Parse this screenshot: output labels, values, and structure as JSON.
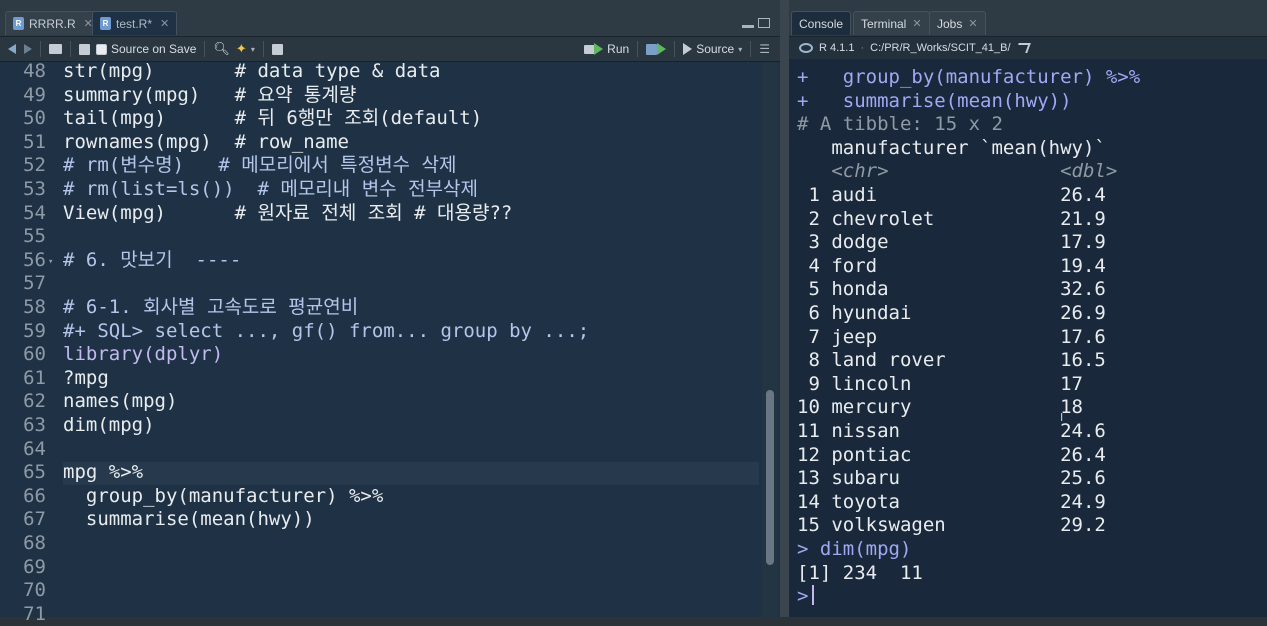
{
  "editor": {
    "tabs": [
      {
        "label": "RRRR.R",
        "icon": "r-file-icon"
      },
      {
        "label": "test.R*",
        "icon": "r-file-icon"
      }
    ],
    "toolbar": {
      "source_on_save": "Source on Save",
      "run": "Run",
      "source": "Source"
    },
    "lines": [
      {
        "num": "48",
        "code": "str(mpg)       # data type & data"
      },
      {
        "num": "49",
        "code": "summary(mpg)   # 요약 통계량"
      },
      {
        "num": "50",
        "code": "tail(mpg)      # 뒤 6행만 조회(default)"
      },
      {
        "num": "51",
        "code": "rownames(mpg)  # row_name"
      },
      {
        "num": "52",
        "code": "# rm(변수명)   # 메모리에서 특정변수 삭제"
      },
      {
        "num": "53",
        "code": "# rm(list=ls())  # 메모리내 변수 전부삭제"
      },
      {
        "num": "54",
        "code": "View(mpg)      # 원자료 전체 조회 # 대용량??"
      },
      {
        "num": "55",
        "code": ""
      },
      {
        "num": "56",
        "code": "# 6. 맛보기  ----"
      },
      {
        "num": "57",
        "code": ""
      },
      {
        "num": "58",
        "code": "# 6-1. 회사별 고속도로 평균연비"
      },
      {
        "num": "59",
        "code": "#+ SQL> select ..., gf() from... group by ...;"
      },
      {
        "num": "60",
        "code": "library(dplyr)"
      },
      {
        "num": "61",
        "code": "?mpg"
      },
      {
        "num": "62",
        "code": "names(mpg)"
      },
      {
        "num": "63",
        "code": "dim(mpg)"
      },
      {
        "num": "64",
        "code": ""
      },
      {
        "num": "65",
        "code": "mpg %>%"
      },
      {
        "num": "66",
        "code": "  group_by(manufacturer) %>%"
      },
      {
        "num": "67",
        "code": "  summarise(mean(hwy))"
      },
      {
        "num": "68",
        "code": ""
      },
      {
        "num": "69",
        "code": ""
      },
      {
        "num": "70",
        "code": ""
      },
      {
        "num": "71",
        "code": ""
      }
    ]
  },
  "console": {
    "tabs": [
      "Console",
      "Terminal",
      "Jobs"
    ],
    "r_version": "R 4.1.1",
    "path": "C:/PR/R_Works/SCIT_41_B/",
    "lines": [
      {
        "text": "+   group_by(manufacturer) %>%",
        "kind": "in"
      },
      {
        "text": "+   summarise(mean(hwy))",
        "kind": "in"
      },
      {
        "text": "# A tibble: 15 x 2",
        "kind": "dim"
      },
      {
        "text": "   manufacturer `mean(hwy)`",
        "kind": "out"
      },
      {
        "text": "   <chr>               <dbl>",
        "kind": "type"
      },
      {
        "text": " 1 audi                26.4",
        "kind": "out"
      },
      {
        "text": " 2 chevrolet           21.9",
        "kind": "out"
      },
      {
        "text": " 3 dodge               17.9",
        "kind": "out"
      },
      {
        "text": " 4 ford                19.4",
        "kind": "out"
      },
      {
        "text": " 5 honda               32.6",
        "kind": "out"
      },
      {
        "text": " 6 hyundai             26.9",
        "kind": "out"
      },
      {
        "text": " 7 jeep                17.6",
        "kind": "out"
      },
      {
        "text": " 8 land rover          16.5",
        "kind": "out"
      },
      {
        "text": " 9 lincoln             17  ",
        "kind": "out"
      },
      {
        "text": "10 mercury             18  ",
        "kind": "out"
      },
      {
        "text": "11 nissan              24.6",
        "kind": "out"
      },
      {
        "text": "12 pontiac             26.4",
        "kind": "out"
      },
      {
        "text": "13 subaru              25.6",
        "kind": "out"
      },
      {
        "text": "14 toyota              24.9",
        "kind": "out"
      },
      {
        "text": "15 volkswagen          29.2",
        "kind": "out"
      },
      {
        "text": "> dim(mpg)",
        "kind": "in"
      },
      {
        "text": "[1] 234  11",
        "kind": "out"
      },
      {
        "text": ">",
        "kind": "in"
      }
    ]
  },
  "colors": {
    "editor_bg": "#1f3245",
    "console_bg": "#19283a",
    "comment": "#b3c5ea",
    "input": "#a3a7f4"
  }
}
